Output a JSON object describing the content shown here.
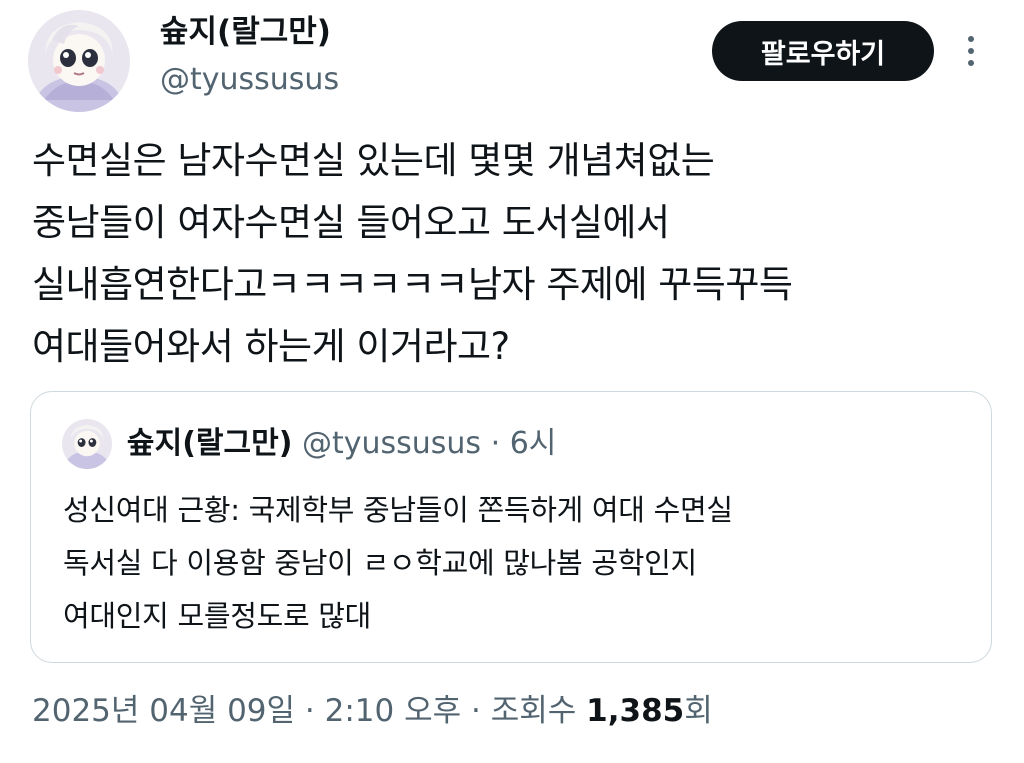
{
  "author": {
    "display_name": "슢지(랄그만)",
    "handle": "@tyussusus"
  },
  "header": {
    "follow_label": "팔로우하기",
    "more_icon": "more-vertical-icon"
  },
  "tweet": {
    "text": "수면실은 남자수면실 있는데 몇몇 개념쳐없는\n중남들이 여자수면실 들어오고 도서실에서\n실내흡연한다고ㅋㅋㅋㅋㅋㅋ남자 주제에 꾸득꾸득\n여대들어와서 하는게 이거라고?"
  },
  "quoted_tweet": {
    "display_name": "슢지(랄그만)",
    "handle": "@tyussusus",
    "separator": "·",
    "time": "6시",
    "text": "성신여대 근황: 국제학부 중남들이 쫀득하게 여대 수면실\n독서실 다 이용함 중남이 ㄹㅇ학교에 많나봄 공학인지\n여대인지 모를정도로 많대"
  },
  "meta": {
    "date": "2025년 04월 09일",
    "separator": "·",
    "time": "2:10 오후",
    "views_label": "조회수",
    "views_count": "1,385",
    "views_suffix": "회"
  },
  "colors": {
    "text_primary": "#0f1419",
    "text_secondary": "#536471",
    "border": "#cfd9de",
    "button_bg": "#0f1419",
    "button_text": "#ffffff"
  }
}
